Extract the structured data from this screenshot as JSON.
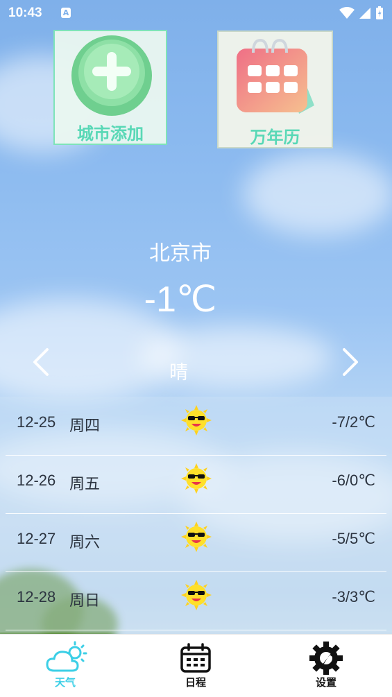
{
  "status": {
    "time": "10:43",
    "notif": "A"
  },
  "shortcuts": {
    "add_city_label": "城市添加",
    "calendar_label": "万年历"
  },
  "weather": {
    "city": "北京市",
    "temperature": "-1℃",
    "condition": "晴"
  },
  "forecast": [
    {
      "date": "12-25",
      "weekday": "周四",
      "range": "-7/2℃",
      "icon": "sun-with-sunglasses-icon"
    },
    {
      "date": "12-26",
      "weekday": "周五",
      "range": "-6/0℃",
      "icon": "sun-with-sunglasses-icon"
    },
    {
      "date": "12-27",
      "weekday": "周六",
      "range": "-5/5℃",
      "icon": "sun-with-sunglasses-icon"
    },
    {
      "date": "12-28",
      "weekday": "周日",
      "range": "-3/3℃",
      "icon": "sun-with-sunglasses-icon"
    }
  ],
  "tabs": [
    {
      "label": "天气",
      "icon": "cloud-sun-icon",
      "active": true
    },
    {
      "label": "日程",
      "icon": "calendar-icon",
      "active": false
    },
    {
      "label": "设置",
      "icon": "gear-wrench-icon",
      "active": false
    }
  ],
  "colors": {
    "accent": "#3ccfe6",
    "card_text": "#59d8b6",
    "card_border": "#7ee3b9"
  }
}
